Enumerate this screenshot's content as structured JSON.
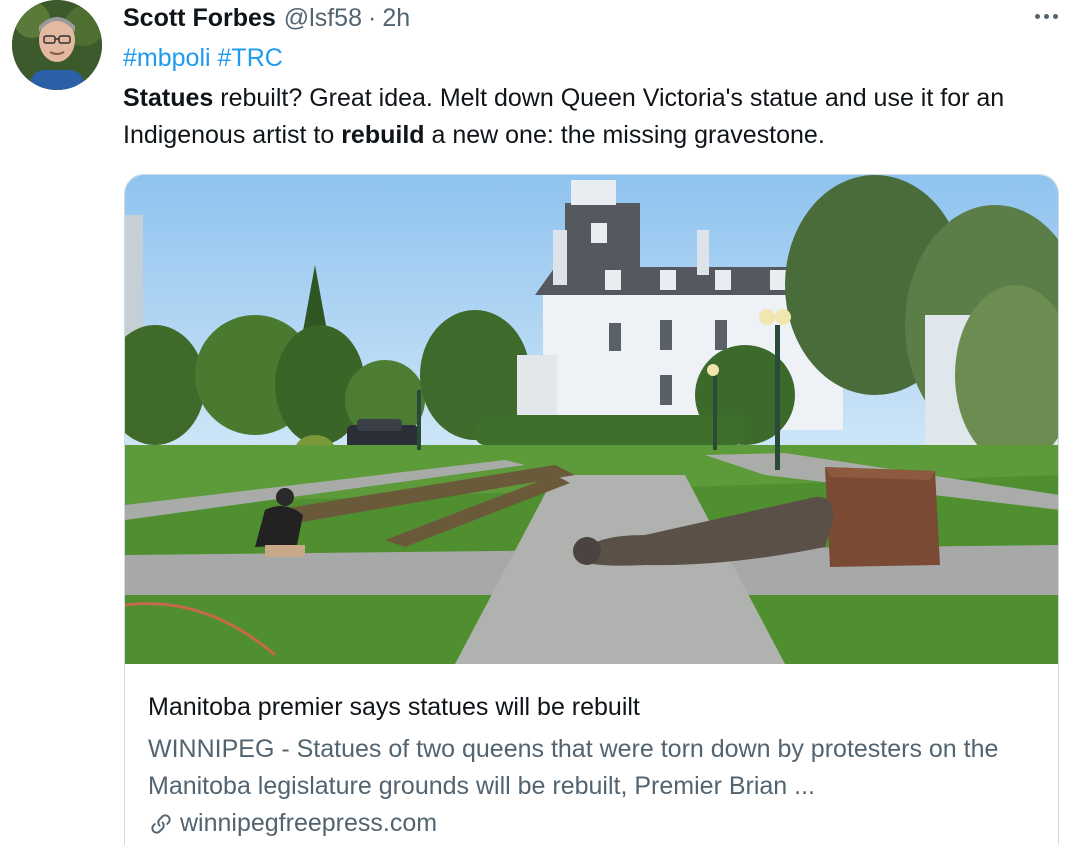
{
  "tweet": {
    "author": {
      "name": "Scott Forbes",
      "handle": "@lsf58",
      "separator": "·",
      "time": "2h",
      "avatar_icon": "profile-photo"
    },
    "hashtags": [
      "#mbpoli",
      "#TRC"
    ],
    "text": {
      "part1_bold": "Statues",
      "part2": " rebuilt? Great idea. Melt down Queen Victoria's statue and use it for an Indigenous artist to ",
      "part3_bold": "rebuild",
      "part4": " a new one: the missing gravestone."
    },
    "menu_icon": "more-options-icon"
  },
  "card": {
    "title": "Manitoba premier says statues will be rebuilt",
    "description": "WINNIPEG - Statues of two queens that were torn down by protesters on the Manitoba legislature grounds will be rebuilt, Premier Brian ...",
    "domain": "winnipegfreepress.com",
    "link_icon": "link-icon",
    "border_color": "#cfd9de"
  },
  "colors": {
    "link": "#1d9bf0",
    "text": "#0f1419",
    "secondary": "#536471"
  }
}
